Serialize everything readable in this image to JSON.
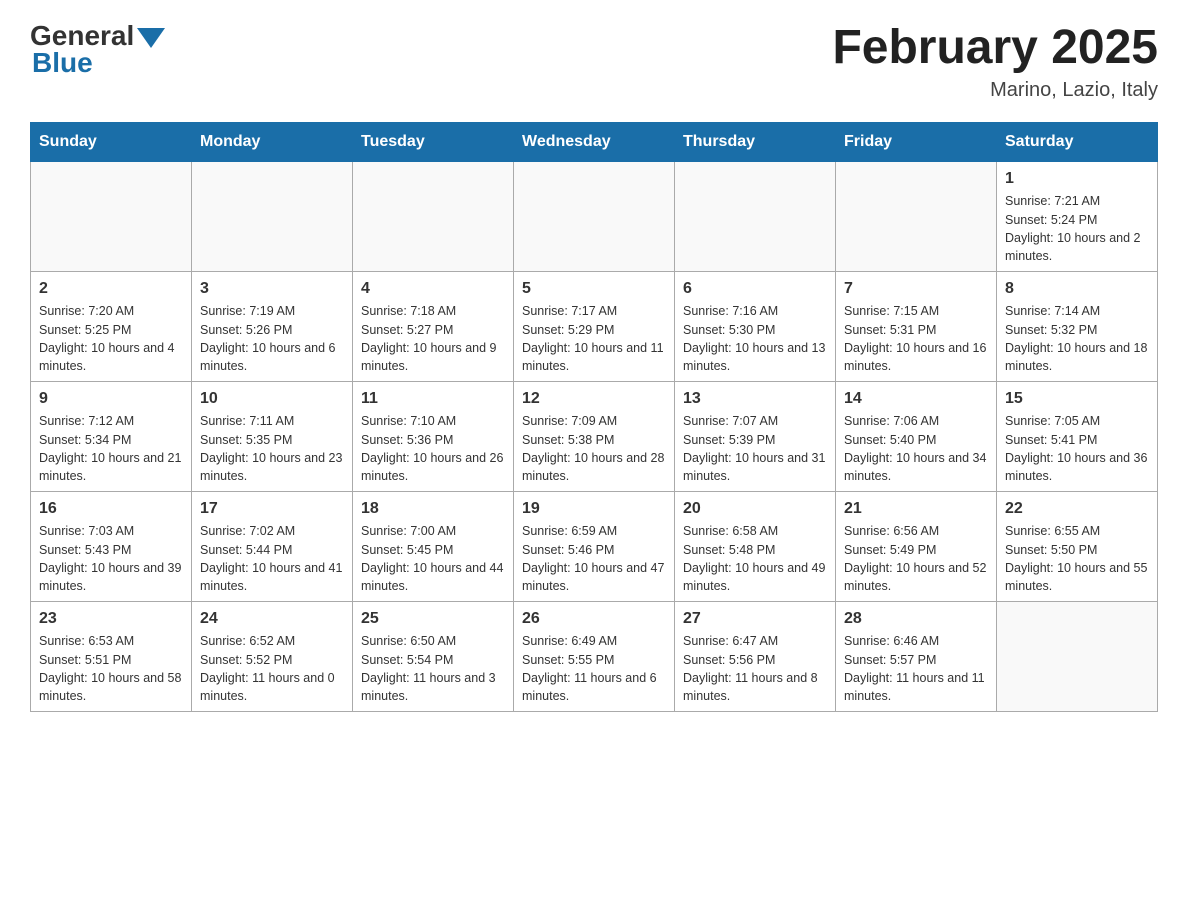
{
  "logo": {
    "general": "General",
    "blue": "Blue"
  },
  "title": {
    "month_year": "February 2025",
    "location": "Marino, Lazio, Italy"
  },
  "headers": [
    "Sunday",
    "Monday",
    "Tuesday",
    "Wednesday",
    "Thursday",
    "Friday",
    "Saturday"
  ],
  "weeks": [
    [
      {
        "day": "",
        "info": ""
      },
      {
        "day": "",
        "info": ""
      },
      {
        "day": "",
        "info": ""
      },
      {
        "day": "",
        "info": ""
      },
      {
        "day": "",
        "info": ""
      },
      {
        "day": "",
        "info": ""
      },
      {
        "day": "1",
        "info": "Sunrise: 7:21 AM\nSunset: 5:24 PM\nDaylight: 10 hours and 2 minutes."
      }
    ],
    [
      {
        "day": "2",
        "info": "Sunrise: 7:20 AM\nSunset: 5:25 PM\nDaylight: 10 hours and 4 minutes."
      },
      {
        "day": "3",
        "info": "Sunrise: 7:19 AM\nSunset: 5:26 PM\nDaylight: 10 hours and 6 minutes."
      },
      {
        "day": "4",
        "info": "Sunrise: 7:18 AM\nSunset: 5:27 PM\nDaylight: 10 hours and 9 minutes."
      },
      {
        "day": "5",
        "info": "Sunrise: 7:17 AM\nSunset: 5:29 PM\nDaylight: 10 hours and 11 minutes."
      },
      {
        "day": "6",
        "info": "Sunrise: 7:16 AM\nSunset: 5:30 PM\nDaylight: 10 hours and 13 minutes."
      },
      {
        "day": "7",
        "info": "Sunrise: 7:15 AM\nSunset: 5:31 PM\nDaylight: 10 hours and 16 minutes."
      },
      {
        "day": "8",
        "info": "Sunrise: 7:14 AM\nSunset: 5:32 PM\nDaylight: 10 hours and 18 minutes."
      }
    ],
    [
      {
        "day": "9",
        "info": "Sunrise: 7:12 AM\nSunset: 5:34 PM\nDaylight: 10 hours and 21 minutes."
      },
      {
        "day": "10",
        "info": "Sunrise: 7:11 AM\nSunset: 5:35 PM\nDaylight: 10 hours and 23 minutes."
      },
      {
        "day": "11",
        "info": "Sunrise: 7:10 AM\nSunset: 5:36 PM\nDaylight: 10 hours and 26 minutes."
      },
      {
        "day": "12",
        "info": "Sunrise: 7:09 AM\nSunset: 5:38 PM\nDaylight: 10 hours and 28 minutes."
      },
      {
        "day": "13",
        "info": "Sunrise: 7:07 AM\nSunset: 5:39 PM\nDaylight: 10 hours and 31 minutes."
      },
      {
        "day": "14",
        "info": "Sunrise: 7:06 AM\nSunset: 5:40 PM\nDaylight: 10 hours and 34 minutes."
      },
      {
        "day": "15",
        "info": "Sunrise: 7:05 AM\nSunset: 5:41 PM\nDaylight: 10 hours and 36 minutes."
      }
    ],
    [
      {
        "day": "16",
        "info": "Sunrise: 7:03 AM\nSunset: 5:43 PM\nDaylight: 10 hours and 39 minutes."
      },
      {
        "day": "17",
        "info": "Sunrise: 7:02 AM\nSunset: 5:44 PM\nDaylight: 10 hours and 41 minutes."
      },
      {
        "day": "18",
        "info": "Sunrise: 7:00 AM\nSunset: 5:45 PM\nDaylight: 10 hours and 44 minutes."
      },
      {
        "day": "19",
        "info": "Sunrise: 6:59 AM\nSunset: 5:46 PM\nDaylight: 10 hours and 47 minutes."
      },
      {
        "day": "20",
        "info": "Sunrise: 6:58 AM\nSunset: 5:48 PM\nDaylight: 10 hours and 49 minutes."
      },
      {
        "day": "21",
        "info": "Sunrise: 6:56 AM\nSunset: 5:49 PM\nDaylight: 10 hours and 52 minutes."
      },
      {
        "day": "22",
        "info": "Sunrise: 6:55 AM\nSunset: 5:50 PM\nDaylight: 10 hours and 55 minutes."
      }
    ],
    [
      {
        "day": "23",
        "info": "Sunrise: 6:53 AM\nSunset: 5:51 PM\nDaylight: 10 hours and 58 minutes."
      },
      {
        "day": "24",
        "info": "Sunrise: 6:52 AM\nSunset: 5:52 PM\nDaylight: 11 hours and 0 minutes."
      },
      {
        "day": "25",
        "info": "Sunrise: 6:50 AM\nSunset: 5:54 PM\nDaylight: 11 hours and 3 minutes."
      },
      {
        "day": "26",
        "info": "Sunrise: 6:49 AM\nSunset: 5:55 PM\nDaylight: 11 hours and 6 minutes."
      },
      {
        "day": "27",
        "info": "Sunrise: 6:47 AM\nSunset: 5:56 PM\nDaylight: 11 hours and 8 minutes."
      },
      {
        "day": "28",
        "info": "Sunrise: 6:46 AM\nSunset: 5:57 PM\nDaylight: 11 hours and 11 minutes."
      },
      {
        "day": "",
        "info": ""
      }
    ]
  ]
}
